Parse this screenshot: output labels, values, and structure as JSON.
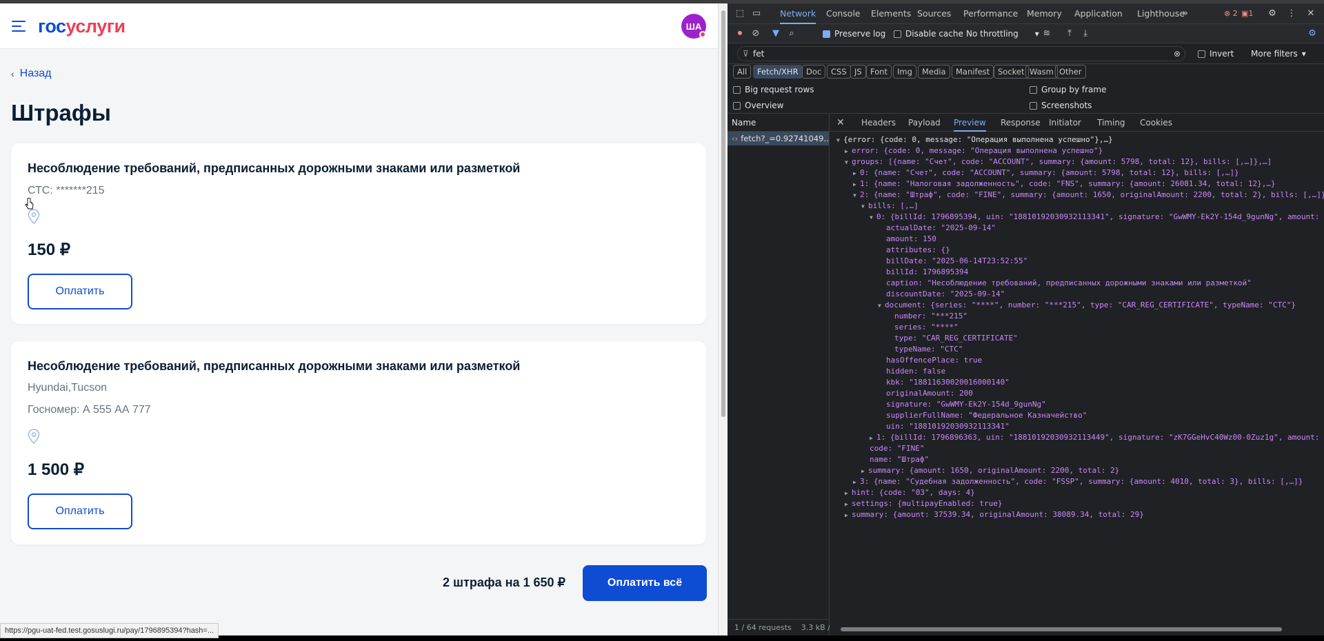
{
  "header": {
    "logo_part1": "гос",
    "logo_part2": "услуги",
    "avatar_initials": "ША"
  },
  "back_label": "Назад",
  "page_title": "Штрафы",
  "fines": [
    {
      "caption": "Несоблюдение требований, предписанных дорожными знаками или разметкой",
      "meta1": "СТС: *******215",
      "meta2": "",
      "amount": "150 ₽",
      "pay_label": "Оплатить"
    },
    {
      "caption": "Несоблюдение требований, предписанных дорожными знаками или разметкой",
      "meta1": "Hyundai,Tucson",
      "meta2": "Госномер: А 555 АА 777",
      "amount": "1 500 ₽",
      "pay_label": "Оплатить"
    }
  ],
  "summary_text": "2 штрафа на 1 650 ₽",
  "pay_all_label": "Оплатить всё",
  "status_url": "https://pgu-uat-fed.test.gosuslugi.ru/pay/1796895394?hash=...",
  "devtools": {
    "tabs": [
      "Network",
      "Console",
      "Elements",
      "Sources",
      "Performance",
      "Memory",
      "Application",
      "Lighthouse"
    ],
    "active_tab": "Network",
    "errors_count": "2",
    "warnings_count": "1",
    "preserve_log": "Preserve log",
    "disable_cache": "Disable cache",
    "throttling": "No throttling",
    "filter_value": "fet",
    "invert": "Invert",
    "more_filters": "More filters",
    "type_filters": [
      "All",
      "Fetch/XHR",
      "Doc",
      "CSS",
      "JS",
      "Font",
      "Img",
      "Media",
      "Manifest",
      "Socket",
      "Wasm",
      "Other"
    ],
    "active_type": "Fetch/XHR",
    "options": {
      "big_rows": "Big request rows",
      "group_frame": "Group by frame",
      "overview": "Overview",
      "screenshots": "Screenshots"
    },
    "name_header": "Name",
    "request_name": "fetch?_=0.92741049...",
    "requests_footer": "1 / 64 requests",
    "size_footer": "3.3 kB /",
    "pane_tabs": [
      "Headers",
      "Payload",
      "Preview",
      "Response",
      "Initiator",
      "Timing",
      "Cookies"
    ],
    "active_pane": "Preview",
    "preview_lines": [
      "{error: {code: 0, message: \"Операция выполнена успешно\"},…}",
      "error: {code: 0, message: \"Операция выполнена успешно\"}",
      "groups: [{name: \"Счет\", code: \"ACCOUNT\", summary: {amount: 5798, total: 12}, bills: [,…]},…]",
      "0: {name: \"Счет\", code: \"ACCOUNT\", summary: {amount: 5798, total: 12}, bills: [,…]}",
      "1: {name: \"Налоговая задолженность\", code: \"FNS\", summary: {amount: 26081.34, total: 12},…}",
      "2: {name: \"Штраф\", code: \"FINE\", summary: {amount: 1650, originalAmount: 2200, total: 2}, bills: [,…]}",
      "bills: [,…]",
      "0: {billId: 1796895394, uin: \"18810192030932113341\", signature: \"GwWMY-Ek2Y-154d_9gunNg\", amount: 150,…}",
      "actualDate: \"2025-09-14\"",
      "amount: 150",
      "attributes: {}",
      "billDate: \"2025-06-14T23:52:55\"",
      "billId: 1796895394",
      "caption: \"Несоблюдение требований, предписанных дорожными знаками или разметкой\"",
      "discountDate: \"2025-09-14\"",
      "document: {series: \"****\", number: \"***215\", type: \"CAR_REG_CERTIFICATE\", typeName: \"СТС\"}",
      "number: \"***215\"",
      "series: \"****\"",
      "type: \"CAR_REG_CERTIFICATE\"",
      "typeName: \"СТС\"",
      "hasOffencePlace: true",
      "hidden: false",
      "kbk: \"18811630020016000140\"",
      "originalAmount: 200",
      "signature: \"GwWMY-Ek2Y-154d_9gunNg\"",
      "supplierFullName: \"Федеральное Казначейство\"",
      "uin: \"18810192030932113341\"",
      "1: {billId: 1796896363, uin: \"18810192030932113449\", signature: \"zK7GGeHvC40Wz00-0Zuz1g\", amount: 1500,…}",
      "code: \"FINE\"",
      "name: \"Штраф\"",
      "summary: {amount: 1650, originalAmount: 2200, total: 2}",
      "3: {name: \"Судебная задолженность\", code: \"FSSP\", summary: {amount: 4010, total: 3}, bills: [,…]}",
      "hint: {code: \"03\", days: 4}",
      "settings: {multipayEnabled: true}",
      "summary: {amount: 37539.34, originalAmount: 38089.34, total: 29}"
    ]
  }
}
